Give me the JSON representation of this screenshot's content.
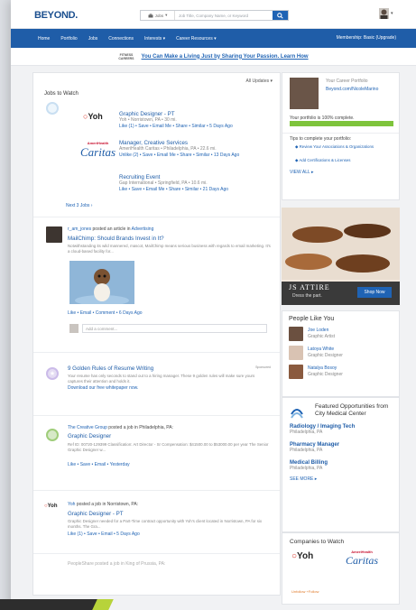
{
  "header": {
    "logo": "BEYOND.",
    "search_scope": "Jobs",
    "search_placeholder": "Job Title, Company Name, or Keyword"
  },
  "nav": {
    "items": [
      "Home",
      "Portfolio",
      "Jobs",
      "Connections",
      "Interests ▾",
      "Career Resources ▾"
    ],
    "right": "Membership: Basic (Upgrade)"
  },
  "promo": {
    "badge": "FITNESS\nCAREERS",
    "link": "You Can Make a Living Just by Sharing Your Passion. Learn How"
  },
  "jobs_card": {
    "title": "Jobs to Watch",
    "filter": "All Updates ▾",
    "jobs": [
      {
        "title": "Graphic Designer - PT",
        "meta": "Yoh • Norristown, PA • 30 mi.",
        "actions": "Like (1) • Save • Email Me • Share • Similar • 5 Days Ago"
      },
      {
        "title": "Manager, Creative Services",
        "meta": "AmeriHealth Caritas • Philadelphia, PA • 22.6 mi.",
        "actions": "Unlike (2) • Save • Email Me • Share • Similar • 13 Days Ago"
      },
      {
        "title": "Recruiting Event",
        "meta": "Gap International • Springfield, PA • 10.6 mi.",
        "actions": "Like • Save • Email Me • Share • Similar • 21 Days Ago"
      }
    ],
    "more": "Next 3 Jobs ›",
    "yoh_logo": "Yoh",
    "caritas_top": "AmeriHealth",
    "caritas_bottom": "Caritas"
  },
  "post_card": {
    "user": "r_am_jones",
    "action": " posted an article in ",
    "topic": "Advertising",
    "title": "MailChimp: Should Brands Invest in It?",
    "excerpt": "Notwithstanding its wild mannered, mascot, MailChimp means serious business with regards to email marketing. It's a cloud-based facility for...",
    "actions": "Like • Email • Comment • 6 Days Ago",
    "comment_placeholder": "Add a comment..."
  },
  "tip_card": {
    "title": "9 Golden Rules of Resume Writing",
    "tag": "Sponsored",
    "body": "Your resume has only seconds to stand out to a hiring manager. These 9 golden rules will make sure yours captures their attention and holds it.",
    "link": "Download our free whitepaper now."
  },
  "creative_card": {
    "company": "The Creative Group",
    "action": " posted a job in Philadelphia, PA:",
    "job": "Graphic Designer",
    "body": "Ref ID: 00720-129399 Classification: Art Director - Sr Compensation: $41500.00 to $53000.00 per year The Senior Graphic Designer w...",
    "actions": "Like • Save • Email • Yesterday"
  },
  "yoh_card": {
    "company": "Yoh",
    "action": " posted a job in Norristown, PA:",
    "job": "Graphic Designer - PT",
    "body": "Graphic Designer needed for a Part-Time contract opportunity with Yoh's client located in Norristown, PA for six months. The Gra...",
    "actions": "Like (1) • Save • Email • 5 Days Ago"
  },
  "last_card": {
    "text": "PeopleShare posted a job in King of Prussia, PA:"
  },
  "portfolio": {
    "label": "Your Career Portfolio",
    "url": "Beyond.com/NicoleMarino",
    "complete": "Your portfolio is 100% complete.",
    "progress": 1.0,
    "tips_title": "Tips to complete your portfolio:",
    "tips": [
      "Review Your Associations & Organizations",
      "Add Certifications & Licenses"
    ],
    "view_all": "VIEW ALL ▸"
  },
  "ad": {
    "brand": "JS ATTIRE",
    "tag": "Dress the part.",
    "button": "Shop Now"
  },
  "people": {
    "title": "People Like You",
    "list": [
      {
        "name": "Joe Loden",
        "role": "Graphic Artist"
      },
      {
        "name": "Latoya White",
        "role": "Graphic Designer"
      },
      {
        "name": "Natalya Bosoy",
        "role": "Graphic Designer"
      }
    ]
  },
  "featured": {
    "title": "Featured Opportunities from City Medical Center",
    "jobs": [
      {
        "title": "Radiology / Imaging Tech",
        "loc": "Philadelphia, PA"
      },
      {
        "title": "Pharmacy Manager",
        "loc": "Philadelphia, PA"
      },
      {
        "title": "Medical Billing",
        "loc": "Philadelphia, PA"
      }
    ],
    "more": "SEE MORE ▸"
  },
  "companies": {
    "title": "Companies to Watch",
    "unfollow": "Unfollow  +Follow"
  },
  "colors": {
    "brand_blue": "#1f5da8",
    "progress_green": "#7ec43c"
  }
}
